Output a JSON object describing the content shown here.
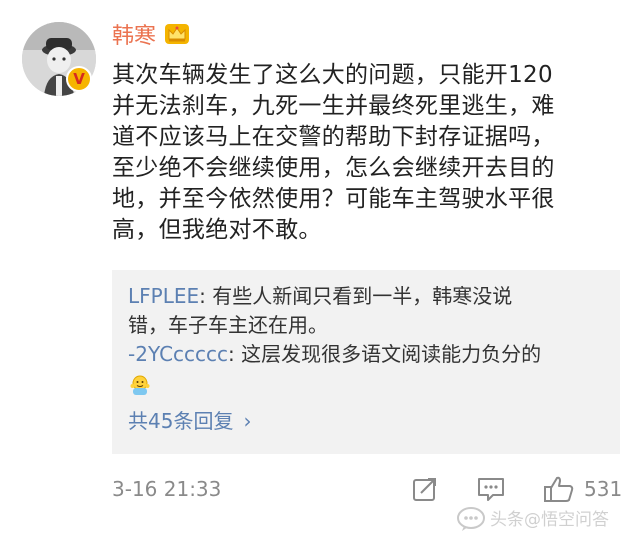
{
  "post": {
    "username": "韩寒",
    "text": "其次车辆发生了这么大的问题，只能开120\n并无法刹车，九死一生并最终死里逃生，难\n道不应该马上在交警的帮助下封存证据吗，\n至少绝不会继续使用，怎么会继续开去目的\n地，并至今依然使用？可能车主驾驶水平很\n高，但我绝对不敢。",
    "timestamp": "3-16 21:33",
    "like_count": "531"
  },
  "replies": [
    {
      "user": "LFPLEE",
      "separator": ": ",
      "text": "有些人新闻只看到一半，韩寒没说\n错，车子车主还在用。"
    },
    {
      "user": "-2YCccccc",
      "separator": ": ",
      "text": "这层发现很多语文阅读能力负分的"
    }
  ],
  "more_replies_label": "共45条回复",
  "icons": {
    "avatar": "avatar-image",
    "verified": "verified-v-badge",
    "vip": "crown-icon",
    "emoji": "emoji-icon",
    "share": "share-icon",
    "comment": "comment-icon",
    "like": "thumbs-up-icon",
    "chevron": "chevron-right-icon"
  },
  "colors": {
    "username": "#eb7350",
    "link": "#5c80b2",
    "text": "#222222",
    "meta": "#8a8a8a",
    "reply_bg": "#f2f2f2"
  },
  "verified_badge_glyph": "V",
  "chevron_glyph": "›",
  "watermark": "头条@悟空问答"
}
